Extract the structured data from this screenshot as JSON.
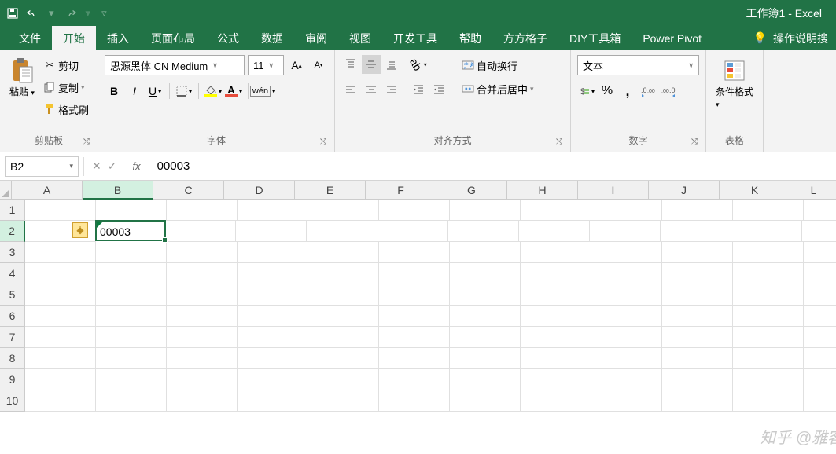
{
  "title": "工作簿1 - Excel",
  "qat": {
    "save": "保存",
    "undo": "撤销",
    "redo": "重做"
  },
  "tabs": {
    "file": "文件",
    "home": "开始",
    "insert": "插入",
    "layout": "页面布局",
    "formulas": "公式",
    "data": "数据",
    "review": "审阅",
    "view": "视图",
    "dev": "开发工具",
    "help": "帮助",
    "fanggezi": "方方格子",
    "diy": "DIY工具箱",
    "powerpivot": "Power Pivot",
    "tell_me": "操作说明搜"
  },
  "clipboard": {
    "paste": "粘贴",
    "cut": "剪切",
    "copy": "复制",
    "format_painter": "格式刷",
    "group_label": "剪贴板"
  },
  "font": {
    "name": "思源黑体 CN Medium",
    "size": "11",
    "bold": "B",
    "italic": "I",
    "underline": "U",
    "group_label": "字体"
  },
  "align": {
    "wrap": "自动换行",
    "merge": "合并后居中",
    "group_label": "对齐方式"
  },
  "number": {
    "format": "文本",
    "group_label": "数字"
  },
  "styles": {
    "cond_format": "条件格式",
    "table_style": "表格"
  },
  "formula_bar": {
    "name_box": "B2",
    "formula": "00003"
  },
  "grid": {
    "cols": [
      "A",
      "B",
      "C",
      "D",
      "E",
      "F",
      "G",
      "H",
      "I",
      "J",
      "K",
      "L"
    ],
    "rows": [
      "1",
      "2",
      "3",
      "4",
      "5",
      "6",
      "7",
      "8",
      "9",
      "10"
    ],
    "selected_col": "B",
    "selected_row": "2",
    "cell_value": "00003"
  },
  "watermark": "知乎 @雅客"
}
